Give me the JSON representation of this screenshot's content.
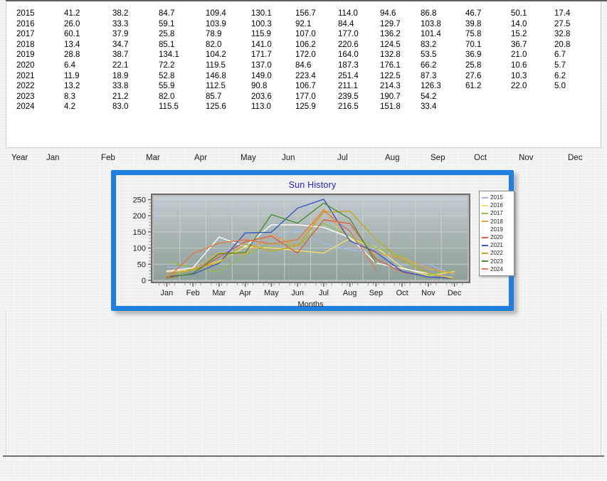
{
  "table": {
    "headers": [
      "Year",
      "Jan",
      "Feb",
      "Mar",
      "Apr",
      "May",
      "Jun",
      "Jul",
      "Aug",
      "Sep",
      "Oct",
      "Nov",
      "Dec"
    ],
    "rows": [
      [
        "2015",
        "41.2",
        "38.2",
        "84.7",
        "109.4",
        "130.1",
        "156.7",
        "114.0",
        "94.6",
        "86.8",
        "46.7",
        "50.1",
        "17.4"
      ],
      [
        "2016",
        "26.0",
        "33.3",
        "59.1",
        "103.9",
        "100.3",
        "92.1",
        "84.4",
        "129.7",
        "103.8",
        "39.8",
        "14.0",
        "27.5"
      ],
      [
        "2017",
        "60.1",
        "37.9",
        "25.8",
        "78.9",
        "115.9",
        "107.0",
        "177.0",
        "136.2",
        "101.4",
        "75.8",
        "15.2",
        "32.8"
      ],
      [
        "2018",
        "13.4",
        "34.7",
        "85.1",
        "82.0",
        "141.0",
        "106.2",
        "220.6",
        "124.5",
        "83.2",
        "70.1",
        "36.7",
        "20.8"
      ],
      [
        "2019",
        "28.8",
        "38.7",
        "134.1",
        "104.2",
        "171.7",
        "172.0",
        "164.0",
        "132.8",
        "53.5",
        "36.9",
        "21.0",
        "6.7"
      ],
      [
        "2020",
        "6.4",
        "22.1",
        "72.2",
        "119.5",
        "137.0",
        "84.6",
        "187.3",
        "176.1",
        "66.2",
        "25.8",
        "10.6",
        "5.7"
      ],
      [
        "2021",
        "11.9",
        "18.9",
        "52.8",
        "146.8",
        "149.0",
        "223.4",
        "251.4",
        "122.5",
        "87.3",
        "27.6",
        "10.3",
        "6.2"
      ],
      [
        "2022",
        "13.2",
        "33.8",
        "55.9",
        "112.5",
        "90.8",
        "106.7",
        "211.1",
        "214.3",
        "126.3",
        "61.2",
        "22.0",
        "5.0"
      ],
      [
        "2023",
        "8.3",
        "21.2",
        "82.0",
        "85.7",
        "203.6",
        "177.0",
        "239.5",
        "190.7",
        "54.2",
        "",
        "",
        ""
      ],
      [
        "2024",
        "4.2",
        "83.0",
        "115.5",
        "125.6",
        "113.0",
        "125.9",
        "216.5",
        "151.8",
        "33.4",
        "",
        "",
        ""
      ]
    ]
  },
  "chart_data": {
    "type": "line",
    "title": "Sun History",
    "xlabel": "Months",
    "ylabel": "",
    "categories": [
      "Jan",
      "Feb",
      "Mar",
      "Apr",
      "May",
      "Jun",
      "Jul",
      "Aug",
      "Sep",
      "Oct",
      "Nov",
      "Dec"
    ],
    "yticks": [
      0,
      50,
      100,
      150,
      200,
      250
    ],
    "ylim": [
      0,
      260
    ],
    "grid": true,
    "legend_position": "right",
    "title_color": "#2222dd",
    "series": [
      {
        "name": "2015",
        "color": "#9db8e8",
        "values": [
          41.2,
          38.2,
          84.7,
          109.4,
          130.1,
          156.7,
          114.0,
          94.6,
          86.8,
          46.7,
          50.1,
          17.4
        ]
      },
      {
        "name": "2016",
        "color": "#f2e06a",
        "values": [
          26.0,
          33.3,
          59.1,
          103.9,
          100.3,
          92.1,
          84.4,
          129.7,
          103.8,
          39.8,
          14.0,
          27.5
        ]
      },
      {
        "name": "2017",
        "color": "#8cc152",
        "values": [
          60.1,
          37.9,
          25.8,
          78.9,
          115.9,
          107.0,
          177.0,
          136.2,
          101.4,
          75.8,
          15.2,
          32.8
        ]
      },
      {
        "name": "2018",
        "color": "#e8a33d",
        "values": [
          13.4,
          34.7,
          85.1,
          82.0,
          141.0,
          106.2,
          220.6,
          124.5,
          83.2,
          70.1,
          36.7,
          20.8
        ]
      },
      {
        "name": "2019",
        "color": "#fdfdfd",
        "values": [
          28.8,
          38.7,
          134.1,
          104.2,
          171.7,
          172.0,
          164.0,
          132.8,
          53.5,
          36.9,
          21.0,
          6.7
        ]
      },
      {
        "name": "2020",
        "color": "#e06040",
        "values": [
          6.4,
          22.1,
          72.2,
          119.5,
          137.0,
          84.6,
          187.3,
          176.1,
          66.2,
          25.8,
          10.6,
          5.7
        ]
      },
      {
        "name": "2021",
        "color": "#3b58c8",
        "values": [
          11.9,
          18.9,
          52.8,
          146.8,
          149.0,
          223.4,
          251.4,
          122.5,
          87.3,
          27.6,
          10.3,
          6.2
        ]
      },
      {
        "name": "2022",
        "color": "#c6a81e",
        "values": [
          13.2,
          33.8,
          55.9,
          112.5,
          90.8,
          106.7,
          211.1,
          214.3,
          126.3,
          61.2,
          22.0,
          5.0
        ]
      },
      {
        "name": "2023",
        "color": "#4f8f2c",
        "values": [
          8.3,
          21.2,
          82.0,
          85.7,
          203.6,
          177.0,
          239.5,
          190.7,
          54.2,
          null,
          null,
          null
        ]
      },
      {
        "name": "2024",
        "color": "#e4794a",
        "values": [
          4.2,
          83.0,
          115.5,
          125.6,
          113.0,
          125.9,
          216.5,
          151.8,
          33.4,
          null,
          null,
          null
        ]
      }
    ]
  }
}
